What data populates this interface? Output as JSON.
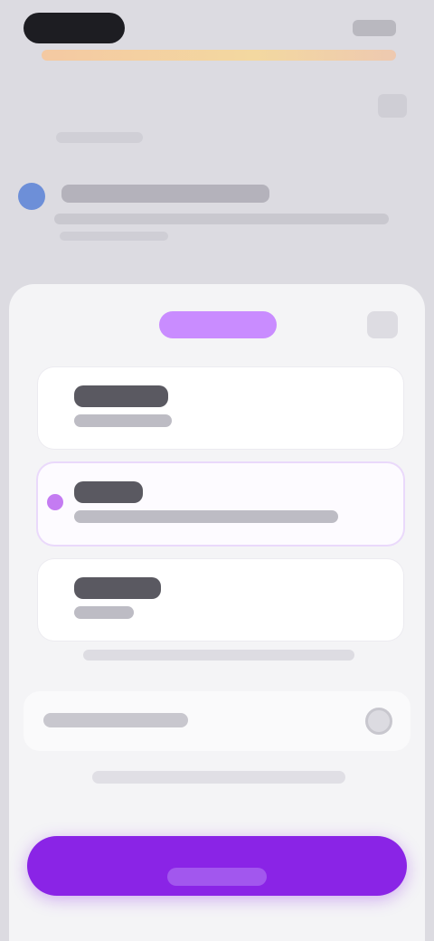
{
  "colors": {
    "accent": "#8a24e6",
    "accent_light": "#c98cff",
    "sheet_background": "#f4f4f6",
    "screen_background": "#dcdbe1"
  },
  "icons": {
    "background_close": "close-icon",
    "sheet_close": "close-icon",
    "info": "info-icon",
    "radio_selected": "radio-selected-icon",
    "toggle": "toggle-icon"
  },
  "options": [
    {
      "title": "",
      "subtitle": "",
      "selected": false
    },
    {
      "title": "",
      "subtitle": "",
      "selected": true
    },
    {
      "title": "",
      "subtitle": "",
      "selected": false
    }
  ]
}
